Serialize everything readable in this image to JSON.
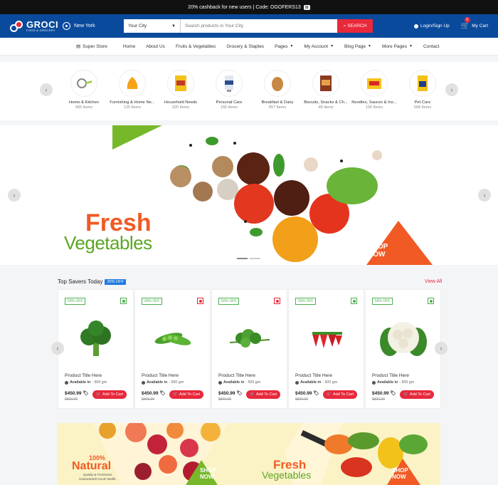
{
  "topbar": {
    "text": "20% cashback for new users | Code: OGOFERS13",
    "tag": "⊞"
  },
  "header": {
    "brand": "GROCI",
    "tagline": "FOOD & GROCERY",
    "location": "New York",
    "city_select": "Your City",
    "search_placeholder": "Search products in Your City",
    "search_button": "SEARCH",
    "login": "Login/Sign Up",
    "cart_label": "My Cart",
    "cart_count": "5"
  },
  "nav": {
    "store": "Super Store",
    "items": [
      "Home",
      "About Us",
      "Fruits & Vegetables",
      "Grocery & Staples",
      "Pages",
      "My Account",
      "Blog Page",
      "More Pages",
      "Contact"
    ]
  },
  "categories": [
    {
      "name": "Home & Kitchen",
      "count": "965 Items",
      "icon": "kitchen-icon"
    },
    {
      "name": "Furnishing & Home Ne...",
      "count": "125 Items",
      "icon": "beanbag-icon"
    },
    {
      "name": "Household Needs",
      "count": "325 Items",
      "icon": "snack-pack-icon"
    },
    {
      "name": "Personal Care",
      "count": "156 Items",
      "icon": "cream-tube-icon"
    },
    {
      "name": "Breakfast & Dairy",
      "count": "857 Items",
      "icon": "egg-icon"
    },
    {
      "name": "Biscuits, Snacks & Ch...",
      "count": "48 Items",
      "icon": "biscuit-icon"
    },
    {
      "name": "Noodles, Sauces & Ins...",
      "count": "156 Items",
      "icon": "noodles-icon"
    },
    {
      "name": "Pet Care",
      "count": "568 Items",
      "icon": "pet-food-icon"
    }
  ],
  "banner": {
    "line1": "Fresh",
    "line2": "Vegetables",
    "cta1": "SHOP",
    "cta2": "NOW"
  },
  "section": {
    "title": "Top Savers Today",
    "badge": "20% OFF",
    "view_all": "View All"
  },
  "products": [
    {
      "discount": "50% OFF",
      "veg": true,
      "title": "Product Title Here",
      "avail_label": "Available in",
      "avail_value": "- 500 gm",
      "price": "$450.99",
      "old_price": "$800.99",
      "cta": "Add To Cart",
      "image": "broccoli-icon"
    },
    {
      "discount": "50% OFF",
      "veg": false,
      "title": "Product Title Here",
      "avail_label": "Available in",
      "avail_value": "- 500 gm",
      "price": "$450.99",
      "old_price": "$800.99",
      "cta": "Add To Cart",
      "image": "peas-icon"
    },
    {
      "discount": "50% OFF",
      "veg": false,
      "title": "Product Title Here",
      "avail_label": "Available in",
      "avail_value": "- 500 gm",
      "price": "$450.99",
      "old_price": "$800.99",
      "cta": "Add To Cart",
      "image": "parsley-icon"
    },
    {
      "discount": "50% OFF",
      "veg": true,
      "title": "Product Title Here",
      "avail_label": "Available in",
      "avail_value": "- 500 gm",
      "price": "$450.99",
      "old_price": "$800.99",
      "cta": "Add To Cart",
      "image": "strawberry-icon"
    },
    {
      "discount": "50% OFF",
      "veg": true,
      "title": "Product Title Here",
      "avail_label": "Available in",
      "avail_value": "- 500 gm",
      "price": "$450.99",
      "old_price": "$800.99",
      "cta": "Add To Cart",
      "image": "cauliflower-icon"
    }
  ],
  "promo": {
    "left": {
      "pct": "100%",
      "word": "Natural",
      "tag1": "Quality & Freshness",
      "tag2": "Guaranteed! Good Health.",
      "cta1": "SHOP",
      "cta2": "NOW"
    },
    "right": {
      "line1": "Fresh",
      "line2": "Vegetables",
      "cta1": "SHOP",
      "cta2": "NOW"
    }
  },
  "colors": {
    "primary": "#0a4a9c",
    "accent": "#e8283b",
    "green": "#76b82a",
    "orange": "#f15a24"
  }
}
